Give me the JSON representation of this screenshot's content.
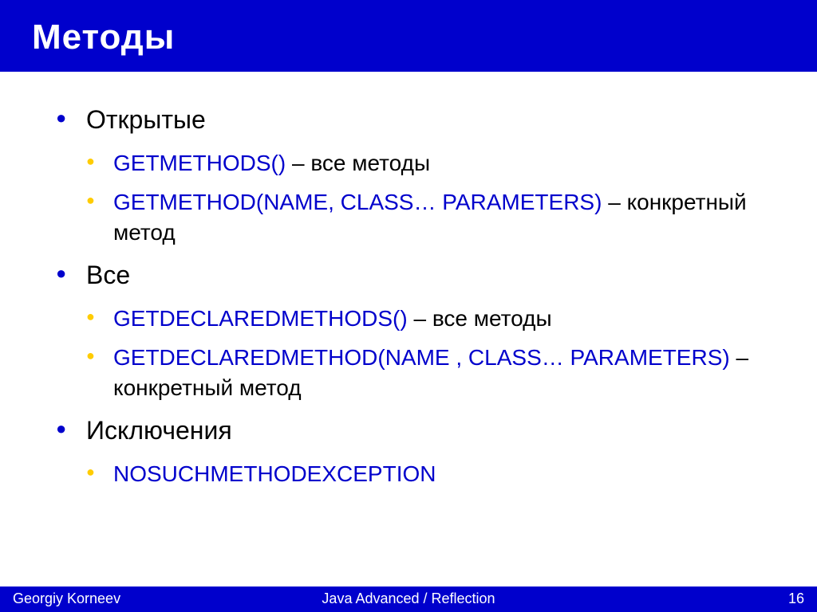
{
  "title": "Методы",
  "sections": [
    {
      "heading": "Открытые",
      "items": [
        {
          "code": "getMethods()",
          "desc": " – все методы"
        },
        {
          "code": "getMethod(name, Class… parameters)",
          "desc": " – конкретный метод"
        }
      ]
    },
    {
      "heading": "Все",
      "items": [
        {
          "code": "getDeclaredMethods()",
          "desc": " – все методы"
        },
        {
          "code": "getDeclaredMethod(name , Class… parameters)",
          "desc": " – конкретный метод"
        }
      ]
    },
    {
      "heading": "Исключения",
      "items": [
        {
          "code": "NoSuchMethodException",
          "desc": ""
        }
      ]
    }
  ],
  "footer": {
    "author": "Georgiy Korneev",
    "course": "Java Advanced / Reflection",
    "page": "16"
  }
}
